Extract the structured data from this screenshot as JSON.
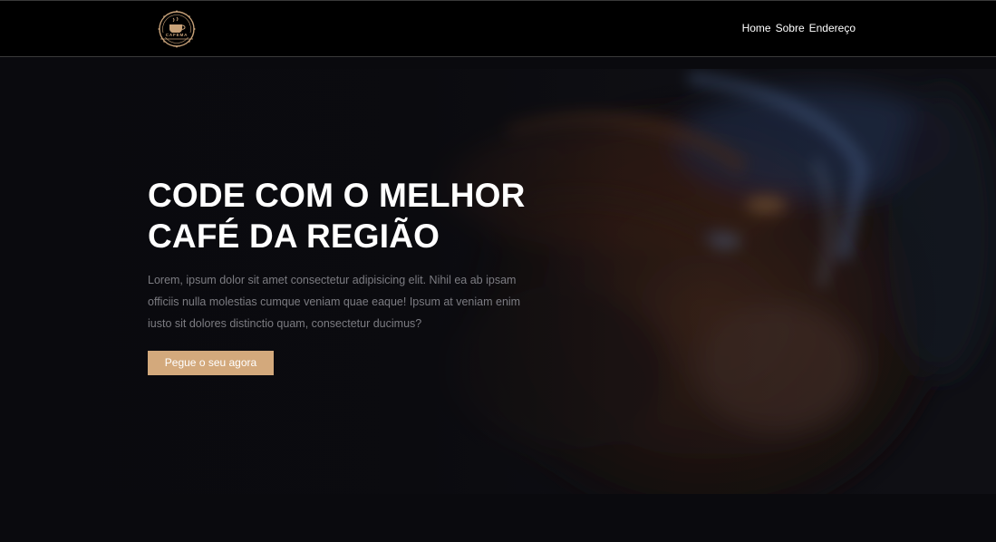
{
  "header": {
    "logo_text": "CAFEMA",
    "nav": [
      {
        "label": "Home"
      },
      {
        "label": "Sobre"
      },
      {
        "label": "Endereço"
      }
    ]
  },
  "hero": {
    "title_line1": "CODE COM O MELHOR",
    "title_line2": "CAFÉ DA REGIÃO",
    "description": "Lorem, ipsum dolor sit amet consectetur adipisicing elit. Nihil ea ab ipsam officiis nulla molestias cumque veniam quae eaque! Ipsum at veniam enim iusto sit dolores distinctio quam, consectetur ducimus?",
    "cta_label": "Pegue o seu agora"
  },
  "colors": {
    "header_bg": "#000000",
    "hero_bg": "#0b0b0f",
    "accent": "#d3a97c",
    "text_primary": "#ffffff",
    "text_muted": "#7c7c82"
  }
}
